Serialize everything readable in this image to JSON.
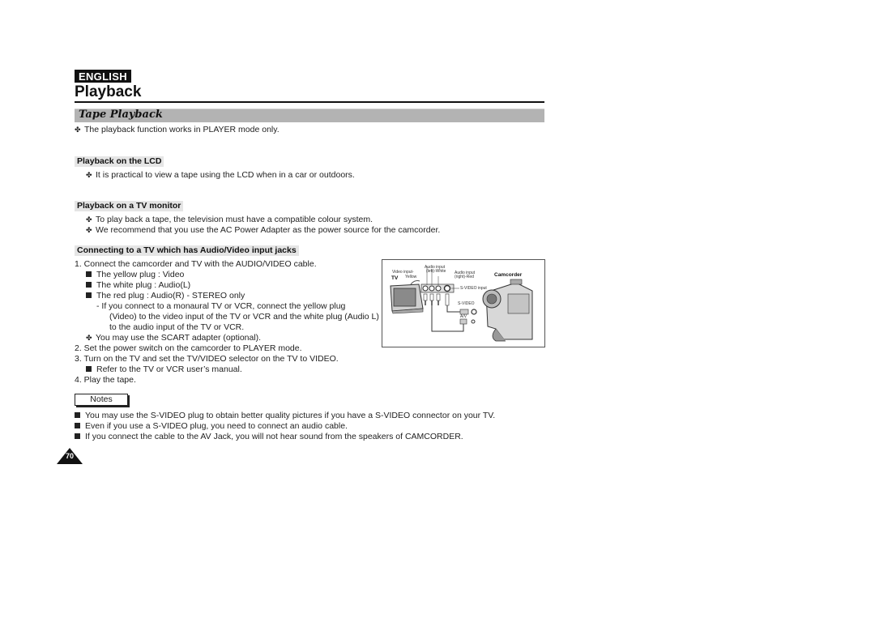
{
  "header": {
    "language_badge": "ENGLISH",
    "page_title": "Playback",
    "section_title": "Tape Playback"
  },
  "intro": {
    "bullet": "The playback function works in PLAYER mode only."
  },
  "lcd": {
    "heading": "Playback on the LCD",
    "bullets": [
      "It is practical to view a tape using the LCD when in a car or outdoors."
    ]
  },
  "tv_monitor": {
    "heading": "Playback on a TV monitor",
    "bullets": [
      "To play back a tape, the television must have a compatible colour system.",
      "We recommend that you use the AC Power Adapter as the power source for the camcorder."
    ]
  },
  "av_jacks": {
    "heading": "Connecting to a TV which has Audio/Video input jacks",
    "step1": "1.  Connect the camcorder and TV with the AUDIO/VIDEO cable.",
    "plugs": [
      "The yellow plug : Video",
      "The white plug : Audio(L)",
      "The red plug : Audio(R) - STEREO only"
    ],
    "mono_note": [
      "-  If you connect to a monaural TV or VCR, connect the yellow plug",
      "(Video) to the video input of the TV or VCR and the white plug (Audio L)",
      "to the audio input of the TV or VCR."
    ],
    "scart": "You may use the SCART adapter (optional).",
    "step2": "2.  Set the power switch on the camcorder to PLAYER mode.",
    "step3": "3.  Turn on the TV and set the TV/VIDEO selector on the TV to VIDEO.",
    "step3_sub": "Refer to the TV or VCR user’s manual.",
    "step4": "4.  Play the tape."
  },
  "diagram": {
    "tv_label": "TV",
    "camcorder_label": "Camcorder",
    "video_input": "Video input-",
    "video_input_color": "Yellow",
    "audio_left": "Audio input",
    "audio_left_color": "(left)-White",
    "audio_right": "Audio input",
    "audio_right_color": "(right)-Red",
    "svideo_input": "S-VIDEO input",
    "svideo": "S-VIDEO",
    "av": "A/V"
  },
  "notes": {
    "label": "Notes",
    "items": [
      "You may use the S-VIDEO plug to obtain better quality pictures if you have a S-VIDEO connector on your TV.",
      "Even if you use a S-VIDEO plug, you need to connect an audio cable.",
      "If you connect the cable to the AV Jack, you will not hear sound from the speakers of CAMCORDER."
    ]
  },
  "footer": {
    "page_number": "70"
  }
}
